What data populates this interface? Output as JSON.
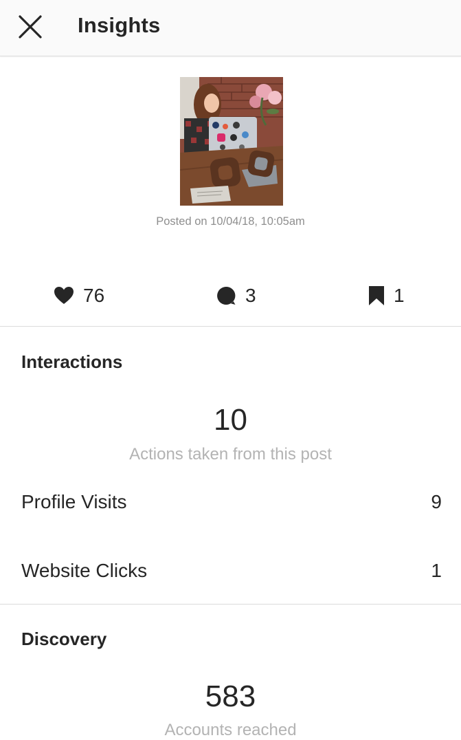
{
  "header": {
    "title": "Insights",
    "close_icon": "close-icon"
  },
  "post": {
    "posted_on": "Posted on 10/04/18, 10:05am"
  },
  "stats": {
    "likes": {
      "icon": "heart-icon",
      "value": "76"
    },
    "comments": {
      "icon": "comment-icon",
      "value": "3"
    },
    "saves": {
      "icon": "bookmark-icon",
      "value": "1"
    }
  },
  "interactions": {
    "title": "Interactions",
    "total": "10",
    "caption": "Actions taken from this post",
    "rows": [
      {
        "label": "Profile Visits",
        "value": "9"
      },
      {
        "label": "Website Clicks",
        "value": "1"
      }
    ]
  },
  "discovery": {
    "title": "Discovery",
    "total": "583",
    "caption": "Accounts reached"
  },
  "colors": {
    "text": "#262626",
    "muted": "#8e8e8e",
    "caption": "#b3b3b3",
    "divider": "#dbdbdb",
    "header_bg": "#fafafa"
  }
}
